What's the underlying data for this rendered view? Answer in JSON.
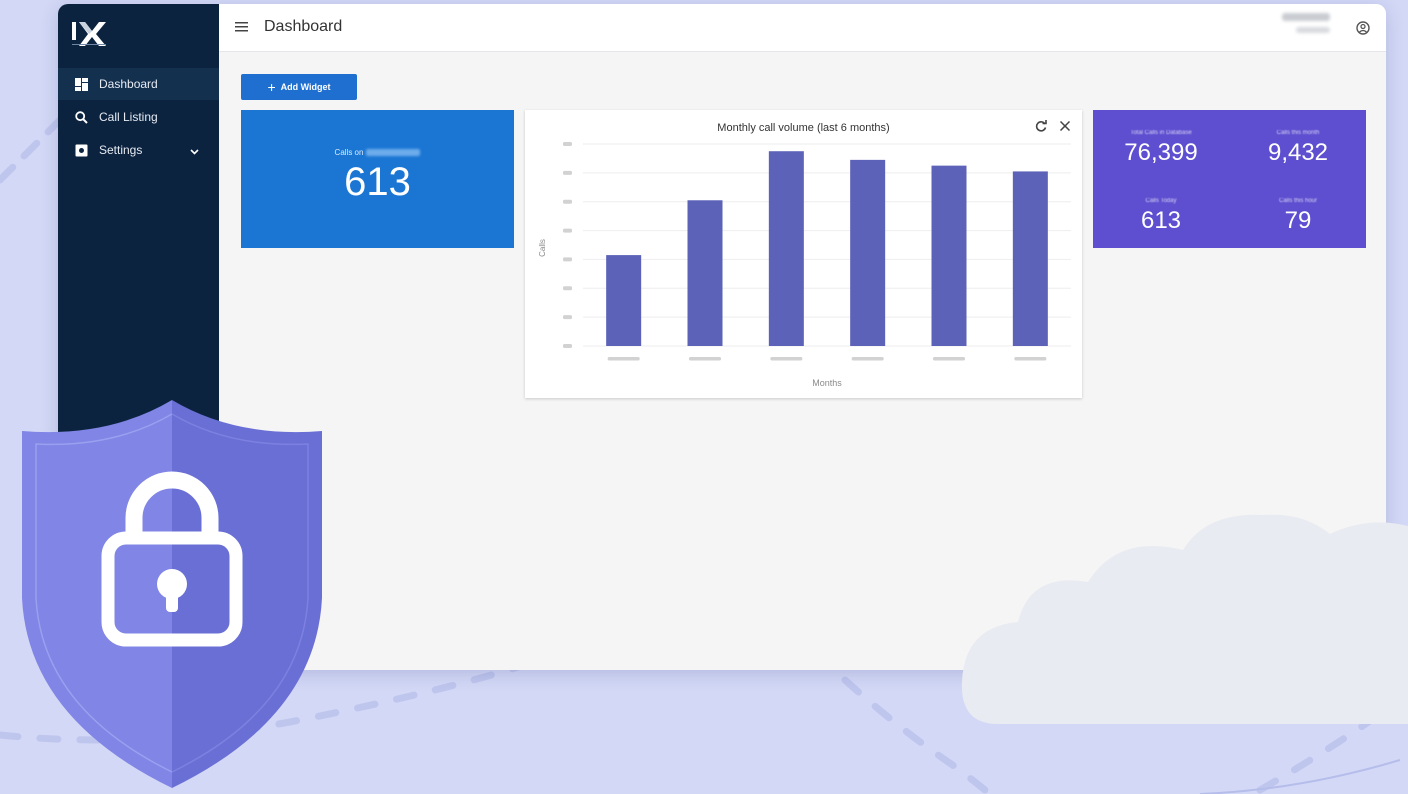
{
  "app": {
    "logo_text": "IX"
  },
  "sidebar": {
    "items": [
      {
        "label": "Dashboard",
        "icon": "dashboard-icon",
        "active": true
      },
      {
        "label": "Call Listing",
        "icon": "search-icon",
        "active": false
      },
      {
        "label": "Settings",
        "icon": "settings-icon",
        "active": false,
        "expandable": true
      }
    ]
  },
  "header": {
    "title": "Dashboard"
  },
  "toolbar": {
    "add_widget_label": "Add Widget"
  },
  "widgets": {
    "calls_today": {
      "label": "Calls on",
      "value": "613"
    },
    "call_volume": {
      "title": "Monthly call volume (last 6 months)",
      "xlabel": "Months",
      "ylabel": "Calls"
    },
    "stats": [
      {
        "label": "Total Calls in Database",
        "value": "76,399"
      },
      {
        "label": "Calls this month",
        "value": "9,432"
      },
      {
        "label": "Calls Today",
        "value": "613"
      },
      {
        "label": "Calls this hour",
        "value": "79"
      }
    ]
  },
  "colors": {
    "sidebar_bg": "#0c2340",
    "primary_button": "#1e6fd0",
    "calls_card": "#1b76d3",
    "stats_card": "#5e4fd0",
    "bar": "#5c62b8"
  },
  "chart_data": {
    "type": "bar",
    "title": "Monthly call volume (last 6 months)",
    "xlabel": "Months",
    "ylabel": "Calls",
    "categories": [
      "",
      "",
      "",
      "",
      "",
      ""
    ],
    "values": [
      315,
      505,
      675,
      645,
      625,
      605
    ],
    "ylim": [
      0,
      700
    ],
    "grid": true
  }
}
